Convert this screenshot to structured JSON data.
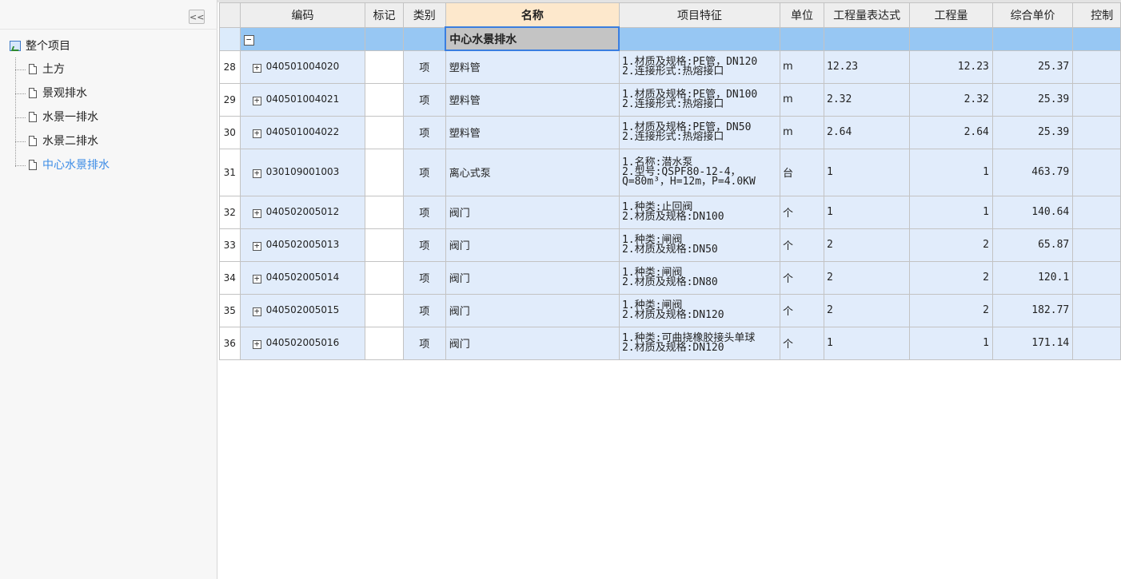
{
  "sidebar": {
    "collapse_label": "<<",
    "root_label": "整个项目",
    "items": [
      {
        "label": "土方"
      },
      {
        "label": "景观排水"
      },
      {
        "label": "水景一排水"
      },
      {
        "label": "水景二排水"
      },
      {
        "label": "中心水景排水",
        "active": true
      }
    ]
  },
  "grid": {
    "columns": [
      "编码",
      "标记",
      "类别",
      "名称",
      "项目特征",
      "单位",
      "工程量表达式",
      "工程量",
      "综合单价",
      "控制"
    ],
    "group": {
      "expander": "−",
      "name": "中心水景排水"
    },
    "rows": [
      {
        "num": "28",
        "code": "040501004020",
        "type": "项",
        "name": "塑料管",
        "features": [
          "1.材质及规格:PE管，DN120",
          "2.连接形式:热熔接口"
        ],
        "unit": "m",
        "expr": "12.23",
        "qty": "12.23",
        "price": "25.37"
      },
      {
        "num": "29",
        "code": "040501004021",
        "type": "项",
        "name": "塑料管",
        "features": [
          "1.材质及规格:PE管，DN100",
          "2.连接形式:热熔接口"
        ],
        "unit": "m",
        "expr": "2.32",
        "qty": "2.32",
        "price": "25.39"
      },
      {
        "num": "30",
        "code": "040501004022",
        "type": "项",
        "name": "塑料管",
        "features": [
          "1.材质及规格:PE管，DN50",
          "2.连接形式:热熔接口"
        ],
        "unit": "m",
        "expr": "2.64",
        "qty": "2.64",
        "price": "25.39"
      },
      {
        "num": "31",
        "code": "030109001003",
        "type": "项",
        "name": "离心式泵",
        "features": [
          "1.名称:潜水泵",
          "2.型号:QSPF80-12-4，",
          "Q=80m³，H=12m，P=4.0KW"
        ],
        "unit": "台",
        "expr": "1",
        "qty": "1",
        "price": "463.79"
      },
      {
        "num": "32",
        "code": "040502005012",
        "type": "项",
        "name": "阀门",
        "features": [
          "1.种类:止回阀",
          "2.材质及规格:DN100"
        ],
        "unit": "个",
        "expr": "1",
        "qty": "1",
        "price": "140.64"
      },
      {
        "num": "33",
        "code": "040502005013",
        "type": "项",
        "name": "阀门",
        "features": [
          "1.种类:闸阀",
          "2.材质及规格:DN50"
        ],
        "unit": "个",
        "expr": "2",
        "qty": "2",
        "price": "65.87"
      },
      {
        "num": "34",
        "code": "040502005014",
        "type": "项",
        "name": "阀门",
        "features": [
          "1.种类:闸阀",
          "2.材质及规格:DN80"
        ],
        "unit": "个",
        "expr": "2",
        "qty": "2",
        "price": "120.1"
      },
      {
        "num": "35",
        "code": "040502005015",
        "type": "项",
        "name": "阀门",
        "features": [
          "1.种类:闸阀",
          "2.材质及规格:DN120"
        ],
        "unit": "个",
        "expr": "2",
        "qty": "2",
        "price": "182.77"
      },
      {
        "num": "36",
        "code": "040502005016",
        "type": "项",
        "name": "阀门",
        "features": [
          "1.种类:可曲挠橡胶接头单球",
          "2.材质及规格:DN120"
        ],
        "unit": "个",
        "expr": "1",
        "qty": "1",
        "price": "171.14"
      }
    ]
  },
  "colors": {
    "group_row": "#97c7f3",
    "data_row": "#e1ecfb",
    "header_highlight": "#fde8cc",
    "active_tree_item": "#3c8ce6"
  }
}
